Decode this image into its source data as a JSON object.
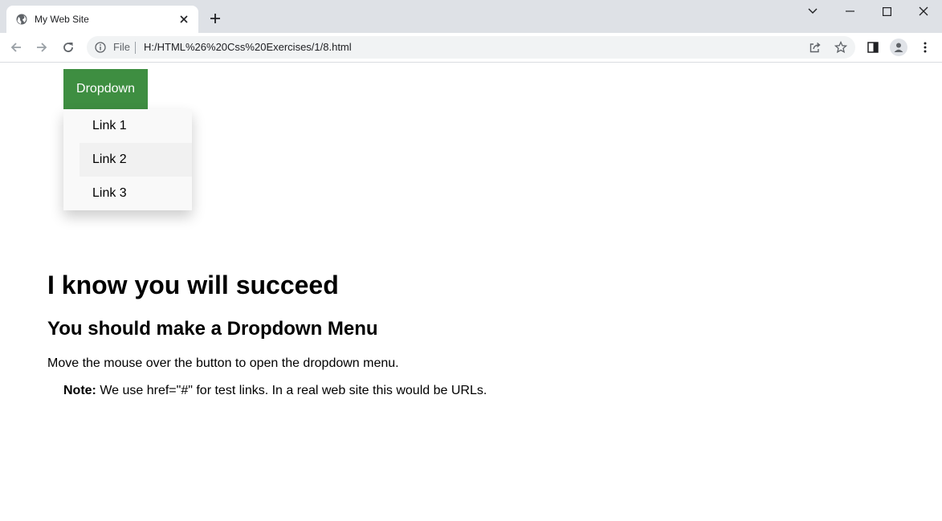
{
  "browser": {
    "tab_title": "My Web Site",
    "scheme_label": "File",
    "url": "H:/HTML%26%20Css%20Exercises/1/8.html"
  },
  "dropdown": {
    "button_label": "Dropdown",
    "links": [
      "Link 1",
      "Link 2",
      "Link 3"
    ],
    "hovered_index": 1,
    "button_color": "#3e8e41"
  },
  "content": {
    "heading": "I know you will succeed",
    "subheading": "You should make a Dropdown Menu",
    "instruction": "Move the mouse over the button to open the dropdown menu.",
    "note_label": "Note:",
    "note_text": " We use href=\"#\" for test links. In a real web site this would be URLs."
  }
}
